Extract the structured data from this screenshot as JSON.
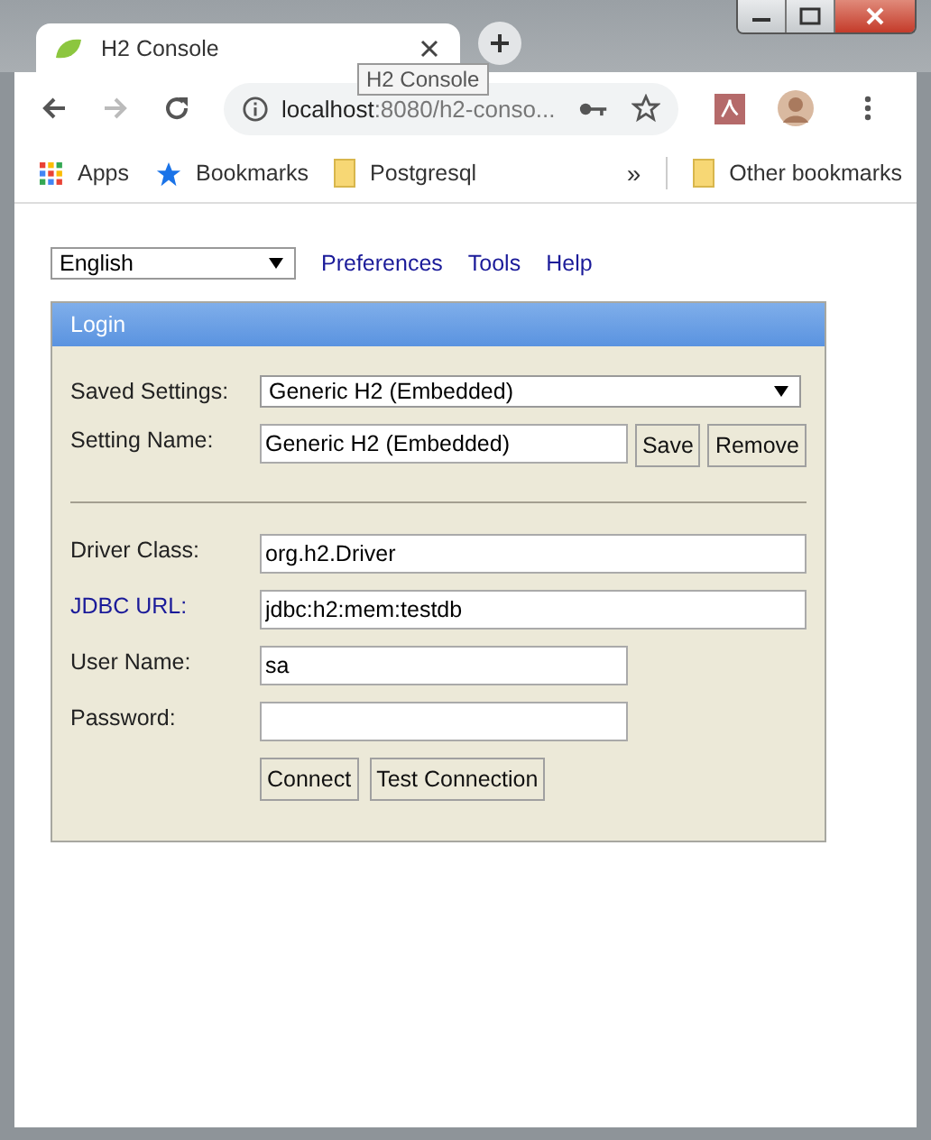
{
  "browser": {
    "tab_title": "H2 Console",
    "tooltip": "H2 Console",
    "address_host": "localhost",
    "address_path": ":8080/h2-conso...",
    "bookmarks": [
      {
        "label": "Apps",
        "kind": "apps"
      },
      {
        "label": "Bookmarks",
        "kind": "star"
      },
      {
        "label": "Postgresql",
        "kind": "folder"
      }
    ],
    "overflow": "»",
    "other_bookmarks": "Other bookmarks"
  },
  "page": {
    "language": "English",
    "links": [
      "Preferences",
      "Tools",
      "Help"
    ],
    "login": {
      "title": "Login",
      "saved_settings": {
        "label": "Saved Settings:",
        "value": "Generic H2 (Embedded)"
      },
      "setting_name": {
        "label": "Setting Name:",
        "value": "Generic H2 (Embedded)",
        "buttons": [
          "Save",
          "Remove"
        ]
      },
      "fields": [
        {
          "label": "Driver Class:",
          "value": "org.h2.Driver",
          "wide": true,
          "link": false,
          "kind": "text"
        },
        {
          "label": "JDBC URL:",
          "value": "jdbc:h2:mem:testdb",
          "wide": true,
          "link": true,
          "kind": "text"
        },
        {
          "label": "User Name:",
          "value": "sa",
          "wide": false,
          "link": false,
          "kind": "text"
        },
        {
          "label": "Password:",
          "wide": false,
          "link": false,
          "kind": "password"
        }
      ],
      "buttons": [
        "Connect",
        "Test Connection"
      ]
    }
  }
}
